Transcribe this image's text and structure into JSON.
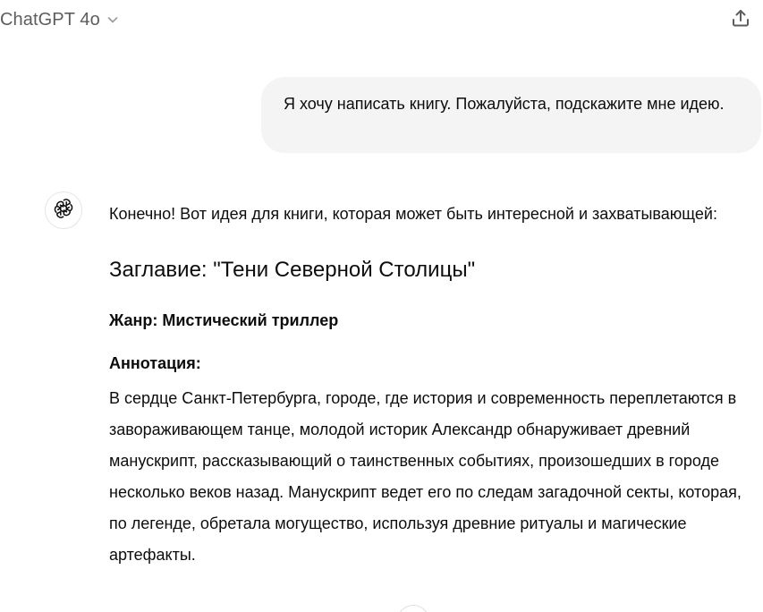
{
  "header": {
    "model_name": "ChatGPT 4o"
  },
  "conversation": {
    "user_message": "Я хочу написать книгу. Пожалуйста, подскажите мне идею.",
    "assistant": {
      "intro": "Конечно! Вот идея для книги, которая может быть интересной и захватывающей:",
      "title": "Заглавие: \"Тени Северной Столицы\"",
      "genre": "Жанр: Мистический триллер",
      "annotation_label": "Аннотация:",
      "annotation_text": "В сердце Санкт-Петербурга, городе, где история и современность переплетаются в завораживающем танце, молодой историк Александр обнаруживает древний манускрипт, рассказывающий о таинственных событиях, произошедших в городе несколько веков назад. Манускрипт ведет его по следам загадочной секты, которая, по легенде, обретала могущество, используя древние ритуалы и магические артефакты."
    }
  },
  "icons": {
    "model_menu": "chevron-down-icon",
    "share": "share-icon",
    "assistant_avatar": "openai-logo-icon"
  },
  "colors": {
    "user_bubble": "#f4f4f4",
    "model_name": "#5d5d5d",
    "text": "#0d0d0d"
  }
}
